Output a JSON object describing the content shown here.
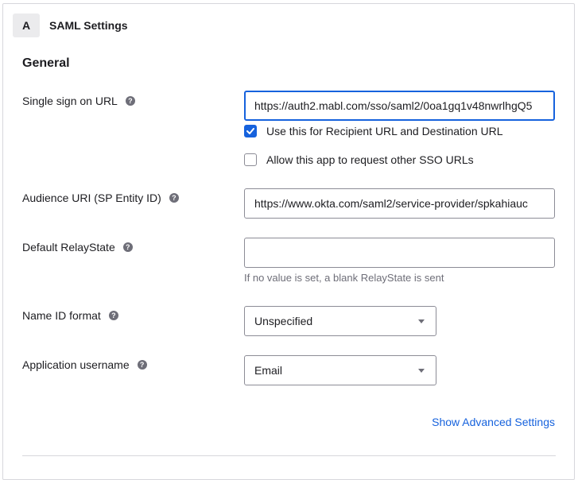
{
  "header": {
    "step": "A",
    "title": "SAML Settings"
  },
  "section": {
    "title": "General"
  },
  "fields": {
    "sso_url": {
      "label": "Single sign on URL",
      "value": "https://auth2.mabl.com/sso/saml2/0oa1gq1v48nwrlhgQ5"
    },
    "recipient_checkbox": {
      "label": "Use this for Recipient URL and Destination URL",
      "checked": true
    },
    "other_sso_checkbox": {
      "label": "Allow this app to request other SSO URLs",
      "checked": false
    },
    "audience_uri": {
      "label": "Audience URI (SP Entity ID)",
      "value": "https://www.okta.com/saml2/service-provider/spkahiauc"
    },
    "relay_state": {
      "label": "Default RelayState",
      "value": "",
      "hint": "If no value is set, a blank RelayState is sent"
    },
    "name_id_format": {
      "label": "Name ID format",
      "selected": "Unspecified"
    },
    "app_username": {
      "label": "Application username",
      "selected": "Email"
    }
  },
  "links": {
    "show_advanced": "Show Advanced Settings"
  },
  "icons": {
    "help": "help-circle-icon",
    "check": "checkmark-icon",
    "dropdown": "chevron-down-icon"
  },
  "colors": {
    "accent": "#1662dd",
    "text": "#1d1d21",
    "muted": "#6e6e78",
    "border": "#8c8c96"
  }
}
